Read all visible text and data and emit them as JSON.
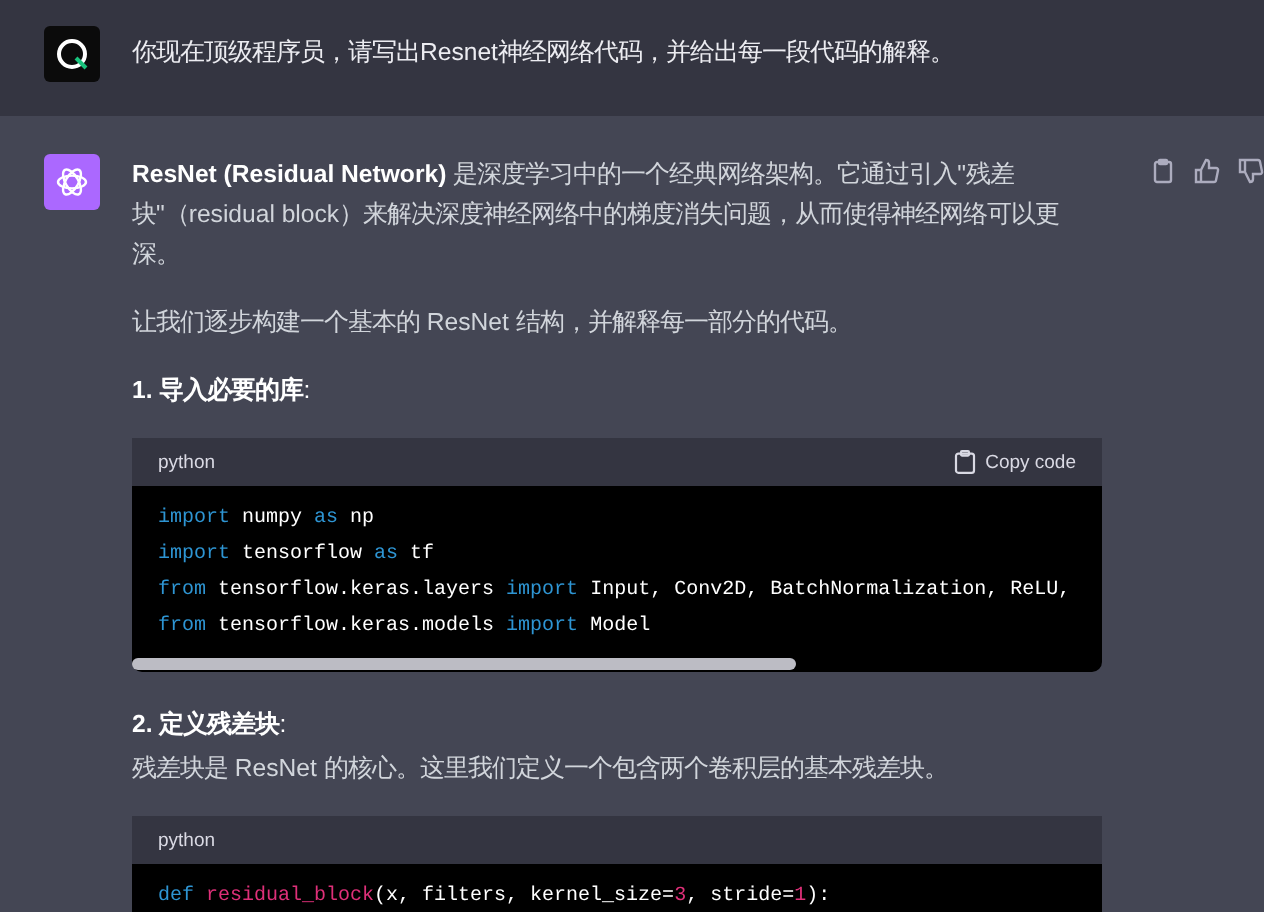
{
  "prompt": {
    "text": "你现在顶级程序员，请写出Resnet神经网络代码，并给出每一段代码的解释。"
  },
  "answer": {
    "blocks": [
      {
        "kind": "paragraph",
        "text": "**ResNet (Residual Network)** 是深度学习中的一个经典网络架构。它通过引入\"残差块\"（residual block）来解决深度神经网络中的梯度消失问题，从而使得神经网络可以更深。"
      },
      {
        "kind": "paragraph",
        "text": "让我们逐步构建一个基本的 ResNet 结构，并解释每一部分的代码。"
      },
      {
        "kind": "heading",
        "text": "**1. 导入必要的库**:"
      },
      {
        "kind": "code",
        "language": "python",
        "copy_label": "Copy code",
        "scrollbar": true,
        "lines": [
          [
            {
              "t": "import",
              "kind": "keyword"
            },
            {
              "t": " numpy ",
              "kind": "plain"
            },
            {
              "t": "as",
              "kind": "keyword"
            },
            {
              "t": " np",
              "kind": "plain"
            }
          ],
          [
            {
              "t": "import",
              "kind": "keyword"
            },
            {
              "t": " tensorflow ",
              "kind": "plain"
            },
            {
              "t": "as",
              "kind": "keyword"
            },
            {
              "t": " tf",
              "kind": "plain"
            }
          ],
          [
            {
              "t": "from",
              "kind": "keyword"
            },
            {
              "t": " tensorflow.keras.layers ",
              "kind": "plain"
            },
            {
              "t": "import",
              "kind": "keyword"
            },
            {
              "t": " Input, Conv2D, BatchNormalization, ReLU,",
              "kind": "plain"
            }
          ],
          [
            {
              "t": "from",
              "kind": "keyword"
            },
            {
              "t": " tensorflow.keras.models ",
              "kind": "plain"
            },
            {
              "t": "import",
              "kind": "keyword"
            },
            {
              "t": " Model",
              "kind": "plain"
            }
          ]
        ]
      },
      {
        "kind": "heading",
        "text": "**2. 定义残差块**:"
      },
      {
        "kind": "paragraph",
        "text": "残差块是 ResNet 的核心。这里我们定义一个包含两个卷积层的基本残差块。"
      },
      {
        "kind": "code",
        "language": "python",
        "lines": [
          [
            {
              "t": "def ",
              "kind": "keyword"
            },
            {
              "t": "residual_block",
              "kind": "function"
            },
            {
              "t": "(x, filters, kernel_size=",
              "kind": "plain"
            },
            {
              "t": "3",
              "kind": "number"
            },
            {
              "t": ", stride=",
              "kind": "plain"
            },
            {
              "t": "1",
              "kind": "number"
            },
            {
              "t": "):",
              "kind": "plain"
            }
          ]
        ]
      }
    ]
  }
}
